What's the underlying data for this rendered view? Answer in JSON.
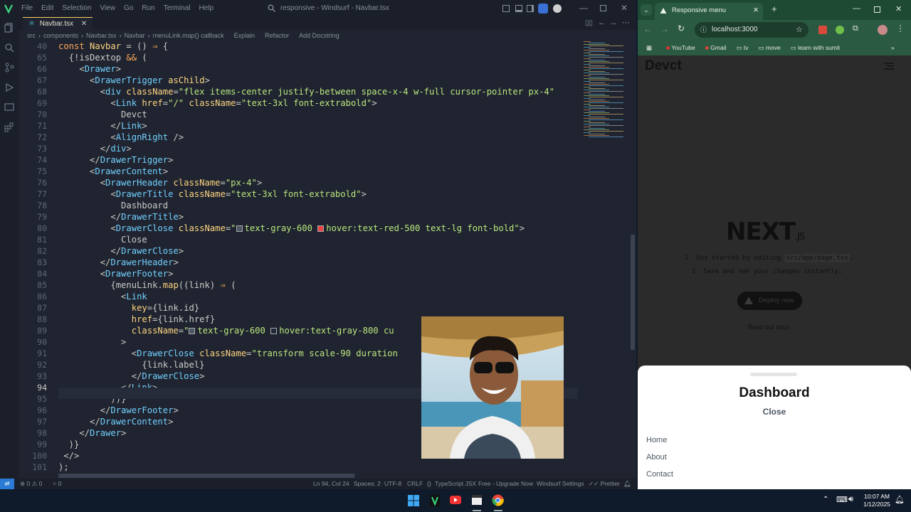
{
  "editor": {
    "menu": [
      "File",
      "Edit",
      "Selection",
      "View",
      "Go",
      "Run",
      "Terminal",
      "Help"
    ],
    "search_text": "responsive - Windsurf - Navbar.tsx",
    "tab_label": "Navbar.tsx",
    "breadcrumbs": [
      "src",
      "components",
      "Navbar.tsx",
      "Navbar",
      "menuLink.map() callback",
      "Explain",
      "Refactor",
      "Add Docstring"
    ],
    "code_lines": [
      {
        "n": "40",
        "html": "<span class='k'>const</span> <span class='f'>Navbar</span> = () <span class='k'>⇒</span> {"
      },
      {
        "n": "65",
        "html": "  {!<span class='v'>isDextop</span> <span class='k'>&amp;&amp;</span> ("
      },
      {
        "n": "66",
        "html": "    &lt;<span class='t'>Drawer</span>&gt;"
      },
      {
        "n": "67",
        "html": "      &lt;<span class='t'>DrawerTrigger</span> <span class='at'>asChild</span>&gt;"
      },
      {
        "n": "68",
        "html": "        &lt;<span class='t'>div</span> <span class='at'>className</span>=<span class='s'>\"flex items-center justify-between space-x-4 w-full cursor-pointer px-4\"</span>"
      },
      {
        "n": "69",
        "html": "          &lt;<span class='t'>Link</span> <span class='at'>href</span>=<span class='s'>\"/\"</span> <span class='at'>className</span>=<span class='s'>\"text-3xl font-extrabold\"</span>&gt;"
      },
      {
        "n": "70",
        "html": "            Devct"
      },
      {
        "n": "71",
        "html": "          &lt;/<span class='t'>Link</span>&gt;"
      },
      {
        "n": "72",
        "html": "          &lt;<span class='t'>AlignRight</span> /&gt;"
      },
      {
        "n": "73",
        "html": "        &lt;/<span class='t'>div</span>&gt;"
      },
      {
        "n": "74",
        "html": "      &lt;/<span class='t'>DrawerTrigger</span>&gt;"
      },
      {
        "n": "75",
        "html": "      &lt;<span class='t'>DrawerContent</span>&gt;"
      },
      {
        "n": "76",
        "html": "        &lt;<span class='t'>DrawerHeader</span> <span class='at'>className</span>=<span class='s'>\"px-4\"</span>&gt;"
      },
      {
        "n": "77",
        "html": "          &lt;<span class='t'>DrawerTitle</span> <span class='at'>className</span>=<span class='s'>\"text-3xl font-extrabold\"</span>&gt;"
      },
      {
        "n": "78",
        "html": "            Dashboard"
      },
      {
        "n": "79",
        "html": "          &lt;/<span class='t'>DrawerTitle</span>&gt;"
      },
      {
        "n": "80",
        "html": "          &lt;<span class='t'>DrawerClose</span> <span class='at'>className</span>=<span class='s'>\"<i class='sw' style='background:#4b5563'></i>text-gray-600 <i class='sw' style='background:#ef4444'></i>hover:text-red-500 text-lg font-bold\"</span>&gt;"
      },
      {
        "n": "81",
        "html": "            Close"
      },
      {
        "n": "82",
        "html": "          &lt;/<span class='t'>DrawerClose</span>&gt;"
      },
      {
        "n": "83",
        "html": "        &lt;/<span class='t'>DrawerHeader</span>&gt;"
      },
      {
        "n": "84",
        "html": "        &lt;<span class='t'>DrawerFooter</span>&gt;"
      },
      {
        "n": "85",
        "html": "          {<span class='v'>menuLink</span>.<span class='f'>map</span>((<span class='v'>link</span>) <span class='k'>⇒</span> ("
      },
      {
        "n": "86",
        "html": "            &lt;<span class='t'>Link</span>"
      },
      {
        "n": "87",
        "html": "              <span class='at'>key</span>={<span class='v'>link</span>.<span class='v'>id</span>}"
      },
      {
        "n": "88",
        "html": "              <span class='at'>href</span>={<span class='v'>link</span>.<span class='v'>href</span>}"
      },
      {
        "n": "89",
        "html": "              <span class='at'>className</span>=<span class='s'>\"<i class='sw' style='background:#4b5563'></i>text-gray-600 <i class='sw' style='background:#1f2937'></i>hover:text-gray-800 cu</span>"
      },
      {
        "n": "90",
        "html": "            &gt;"
      },
      {
        "n": "91",
        "html": "              &lt;<span class='t'>DrawerClose</span> <span class='at'>className</span>=<span class='s'>\"transform scale-90 duration                       sca</span>"
      },
      {
        "n": "92",
        "html": "                {<span class='v'>link</span>.<span class='v'>label</span>}"
      },
      {
        "n": "93",
        "html": "              &lt;/<span class='t'>DrawerClose</span>&gt;"
      },
      {
        "n": "94",
        "html": "            &lt;/<span class='t'>Link</span>&gt;"
      },
      {
        "n": "95",
        "html": "          ))}"
      },
      {
        "n": "96",
        "html": "        &lt;/<span class='t'>DrawerFooter</span>&gt;"
      },
      {
        "n": "97",
        "html": "      &lt;/<span class='t'>DrawerContent</span>&gt;"
      },
      {
        "n": "98",
        "html": "    &lt;/<span class='t'>Drawer</span>&gt;"
      },
      {
        "n": "99",
        "html": "  )}"
      },
      {
        "n": "100",
        "html": " &lt;/&gt;"
      },
      {
        "n": "101",
        "html": ");"
      }
    ],
    "status": {
      "errors": "0",
      "warnings": "0",
      "ports": "0",
      "position": "Ln 94, Col 24",
      "spaces": "Spaces: 2",
      "encoding": "UTF-8",
      "eol": "CRLF",
      "language": "TypeScript JSX",
      "plan": "Free - Upgrade Now",
      "settings": "Windsurf Settings",
      "prettier": "Prettier"
    }
  },
  "browser": {
    "tab_title": "Responsive menu",
    "url": "localhost:3000",
    "bookmarks": [
      "YouTube",
      "Gmail",
      "tv",
      "move",
      "learn with sumit"
    ],
    "site_logo": "Devct",
    "next_logo": "NEXT",
    "next_suffix": ".JS",
    "step1_prefix": "1. Get started by editing",
    "step1_code": "src/app/page.tsx",
    "step1_suffix": ".",
    "step2": "2. Save and see your changes instantly.",
    "deploy_label": "Deploy now",
    "docs_label": "Read our docs",
    "drawer": {
      "title": "Dashboard",
      "close": "Close",
      "links": [
        "Home",
        "About",
        "Contact"
      ]
    }
  },
  "taskbar": {
    "time": "10:07 AM",
    "date": "1/12/2025"
  },
  "colors": {
    "editor_bg": "#1f2430",
    "browser_frame": "#2b5a42",
    "accent": "#2b7bd6"
  }
}
